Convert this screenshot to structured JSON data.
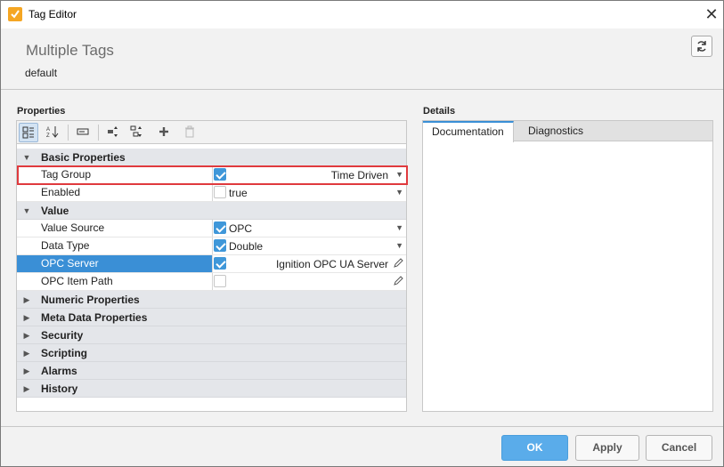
{
  "window": {
    "title": "Tag Editor",
    "close_glyph": "✕"
  },
  "header": {
    "title": "Multiple Tags",
    "subtitle": "default"
  },
  "properties": {
    "label": "Properties",
    "rows": [
      {
        "type": "section",
        "label": "Basic Properties",
        "expanded": true
      },
      {
        "type": "prop",
        "label": "Tag Group",
        "checked": true,
        "value": "Time Driven",
        "value_align": "right",
        "control": "dropdown",
        "highlighted": true
      },
      {
        "type": "prop",
        "label": "Enabled",
        "checked": false,
        "value": "true",
        "value_align": "left",
        "control": "dropdown"
      },
      {
        "type": "section",
        "label": "Value",
        "expanded": true
      },
      {
        "type": "prop",
        "label": "Value Source",
        "checked": true,
        "value": "OPC",
        "value_align": "left",
        "control": "dropdown"
      },
      {
        "type": "prop",
        "label": "Data Type",
        "checked": true,
        "value": "Double",
        "value_align": "left",
        "control": "dropdown"
      },
      {
        "type": "prop",
        "label": "OPC Server",
        "checked": true,
        "value": "Ignition OPC UA Server",
        "value_align": "right",
        "control": "edit",
        "selected": true
      },
      {
        "type": "prop",
        "label": "OPC Item Path",
        "checked": false,
        "value": "",
        "value_align": "right",
        "control": "edit"
      },
      {
        "type": "section",
        "label": "Numeric Properties",
        "expanded": false
      },
      {
        "type": "section",
        "label": "Meta Data Properties",
        "expanded": false
      },
      {
        "type": "section",
        "label": "Security",
        "expanded": false
      },
      {
        "type": "section",
        "label": "Scripting",
        "expanded": false
      },
      {
        "type": "section",
        "label": "Alarms",
        "expanded": false
      },
      {
        "type": "section",
        "label": "History",
        "expanded": false
      }
    ]
  },
  "details": {
    "label": "Details",
    "tabs": [
      {
        "label": "Documentation",
        "active": true
      },
      {
        "label": "Diagnostics",
        "active": false
      }
    ]
  },
  "footer": {
    "ok_label": "OK",
    "apply_label": "Apply",
    "cancel_label": "Cancel"
  },
  "colors": {
    "accent": "#3a8fd6",
    "highlight_border": "#e03a3e",
    "ok_button": "#5aacea",
    "checkbox_on": "#3f97d9"
  }
}
